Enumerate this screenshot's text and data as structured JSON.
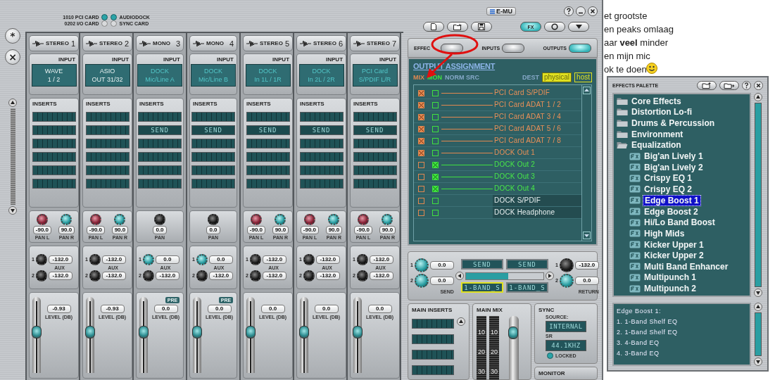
{
  "background_text": {
    "lines": [
      "et grootste",
      "en peaks omlaag",
      "aar **veel** minder",
      "en mijn mic",
      "ok te doen"
    ]
  },
  "mixer": {
    "rail": {
      "buttons": [
        "*",
        "×"
      ]
    },
    "legend": [
      {
        "label": "1010 PCI CARD",
        "on": true
      },
      {
        "label": "AUDIODOCK",
        "on": true
      },
      {
        "label": "0202 I/O CARD",
        "on": false
      },
      {
        "label": "SYNC CARD",
        "on": false
      }
    ],
    "channels": [
      {
        "kind": "stereo",
        "type_label": "STEREO",
        "number": "1",
        "input_label": "INPUT",
        "input": [
          "WAVE",
          "1 / 2"
        ],
        "lit": true,
        "inserts_label": "INSERTS",
        "pan": [
          {
            "value": "-90.0",
            "label": "PAN L"
          },
          {
            "value": "90.0",
            "label": "PAN R"
          }
        ],
        "aux_label": "AUX",
        "aux": [
          {
            "number": "1",
            "value": "-132.0",
            "on": false
          },
          {
            "number": "2",
            "value": "-132.0",
            "on": false
          }
        ],
        "level_value": "-0.93",
        "level_label": "LEVEL (DB)",
        "level": 0.55
      },
      {
        "kind": "stereo",
        "type_label": "STEREO",
        "number": "2",
        "input_label": "INPUT",
        "input": [
          "ASIO",
          "OUT 31/32"
        ],
        "lit": true,
        "inserts_label": "INSERTS",
        "pan": [
          {
            "value": "-90.0",
            "label": "PAN L"
          },
          {
            "value": "90.0",
            "label": "PAN R"
          }
        ],
        "aux_label": "AUX",
        "aux": [
          {
            "number": "1",
            "value": "-132.0",
            "on": false
          },
          {
            "number": "2",
            "value": "-132.0",
            "on": false
          }
        ],
        "level_value": "-0.93",
        "level_label": "LEVEL (DB)",
        "level": 0.55
      },
      {
        "kind": "mono",
        "type_label": "MONO",
        "number": "3",
        "input_label": "INPUT",
        "input": [
          "DOCK",
          "Mic/Line A"
        ],
        "lit": false,
        "inserts_label": "INSERTS",
        "send": "SEND",
        "pan": [
          {
            "value": "0.0",
            "label": "PAN"
          }
        ],
        "aux_label": "AUX",
        "aux": [
          {
            "number": "1",
            "value": "0.0",
            "on": true
          },
          {
            "number": "2",
            "value": "-132.0",
            "on": false
          }
        ],
        "badge": "PRE",
        "level_value": "0.0",
        "level_label": "LEVEL (DB)",
        "level": 0.55
      },
      {
        "kind": "mono",
        "type_label": "MONO",
        "number": "4",
        "input_label": "INPUT",
        "input": [
          "DOCK",
          "Mic/Line B"
        ],
        "lit": false,
        "inserts_label": "INSERTS",
        "send": "SEND",
        "pan": [
          {
            "value": "0.0",
            "label": "PAN"
          }
        ],
        "aux_label": "AUX",
        "aux": [
          {
            "number": "1",
            "value": "0.0",
            "on": true
          },
          {
            "number": "2",
            "value": "-132.0",
            "on": false
          }
        ],
        "badge": "PRE",
        "level_value": "0.0",
        "level_label": "LEVEL (DB)",
        "level": 0.55
      },
      {
        "kind": "stereo",
        "type_label": "STEREO",
        "number": "5",
        "input_label": "INPUT",
        "input": [
          "DOCK",
          "In 1L / 1R"
        ],
        "lit": false,
        "inserts_label": "INSERTS",
        "send": "SEND",
        "pan": [
          {
            "value": "-90.0",
            "label": "PAN L"
          },
          {
            "value": "90.0",
            "label": "PAN R"
          }
        ],
        "aux_label": "AUX",
        "aux": [
          {
            "number": "1",
            "value": "-132.0",
            "on": false
          },
          {
            "number": "2",
            "value": "-132.0",
            "on": false
          }
        ],
        "level_value": "0.0",
        "level_label": "LEVEL (DB)",
        "level": 0.55
      },
      {
        "kind": "stereo",
        "type_label": "STEREO",
        "number": "6",
        "input_label": "INPUT",
        "input": [
          "DOCK",
          "In 2L / 2R"
        ],
        "lit": false,
        "inserts_label": "INSERTS",
        "send": "SEND",
        "pan": [
          {
            "value": "-90.0",
            "label": "PAN L"
          },
          {
            "value": "90.0",
            "label": "PAN R"
          }
        ],
        "aux_label": "AUX",
        "aux": [
          {
            "number": "1",
            "value": "-132.0",
            "on": false
          },
          {
            "number": "2",
            "value": "-132.0",
            "on": false
          }
        ],
        "level_value": "0.0",
        "level_label": "LEVEL (DB)",
        "level": 0.55
      },
      {
        "kind": "stereo",
        "type_label": "STEREO",
        "number": "7",
        "input_label": "INPUT",
        "input": [
          "PCI Card",
          "S/PDIF L/R"
        ],
        "lit": false,
        "inserts_label": "INSERTS",
        "send": "SEND",
        "pan": [
          {
            "value": "-90.0",
            "label": "PAN L"
          },
          {
            "value": "90.0",
            "label": "PAN R"
          }
        ],
        "aux_label": "AUX",
        "aux": [
          {
            "number": "1",
            "value": "-132.0",
            "on": false
          },
          {
            "number": "2",
            "value": "-132.0",
            "on": false
          }
        ],
        "level_value": "0.0",
        "level_label": "LEVEL (DB)",
        "level": 0.55
      }
    ],
    "console": {
      "logo": "E-MU",
      "fx": {
        "label": "FX",
        "on": true
      },
      "tabs": [
        {
          "label": "EFFEC",
          "selected": false
        },
        {
          "label": "INPUTS",
          "selected": false
        },
        {
          "label": "OUTPUTS",
          "selected": true
        }
      ],
      "assignment": {
        "title": "OUTPUT ASSIGNMENT",
        "mix_header": "MIX",
        "mon_header": "MON",
        "norm_header": "NORM SRC",
        "dest_header": "DEST",
        "dest_toggle": [
          {
            "label": "physical",
            "selected": true
          },
          {
            "label": "host",
            "selected": false
          }
        ],
        "rows": [
          {
            "name": "PCI Card S/PDIF",
            "mix": true,
            "mon": false
          },
          {
            "name": "PCI Card ADAT 1 / 2",
            "mix": true,
            "mon": false
          },
          {
            "name": "PCI Card ADAT 3 / 4",
            "mix": true,
            "mon": false
          },
          {
            "name": "PCI Card ADAT 5 / 6",
            "mix": true,
            "mon": false
          },
          {
            "name": "PCI Card ADAT 7 / 8",
            "mix": true,
            "mon": false
          },
          {
            "name": "DOCK Out 1",
            "mix": true,
            "mon": false
          },
          {
            "name": "DOCK Out 2",
            "mix": false,
            "mon": true
          },
          {
            "name": "DOCK Out 3",
            "mix": false,
            "mon": true
          },
          {
            "name": "DOCK Out 4",
            "mix": false,
            "mon": true
          },
          {
            "name": "DOCK S/PDIF",
            "mix": false,
            "mon": false
          },
          {
            "name": "DOCK Headphone",
            "mix": false,
            "mon": false
          }
        ]
      },
      "send": {
        "label": "SEND",
        "knobs": [
          {
            "number": "1",
            "value": "0.0",
            "on": true
          },
          {
            "number": "2",
            "value": "0.0",
            "on": true
          }
        ],
        "slots": [
          "SEND",
          "SEND"
        ],
        "effects": [
          {
            "text": "1-BAND_S",
            "selected": true
          },
          {
            "text": "1-BAND_S",
            "selected": false
          }
        ]
      },
      "return": {
        "label": "RETURN",
        "knobs": [
          {
            "number": "1",
            "value": "-132.0",
            "on": false
          },
          {
            "number": "2",
            "value": "0.0",
            "on": true
          }
        ]
      },
      "main_inserts": {
        "title": "MAIN INSERTS"
      },
      "main_mix": {
        "title": "MAIN MIX",
        "meters": [
          {
            "scale": [
              "10",
              "20",
              "30"
            ]
          },
          {
            "scale": [
              "10",
              "20",
              "30"
            ]
          }
        ],
        "level": 0.8
      },
      "sync": {
        "title": "SYNC",
        "source_label": "SOURCE:",
        "source": "INTERNAL",
        "sr_label": "SR",
        "sr": "44.1KHZ",
        "locked": {
          "label": "LOCKED",
          "on": true
        }
      },
      "monitor": {
        "title": "MONITOR"
      }
    }
  },
  "palette": {
    "title": "EFFECTS PALETTE",
    "tree": [
      {
        "label": "Core Effects",
        "expanded": false,
        "selected": false
      },
      {
        "label": "Distortion Lo-fi",
        "expanded": false,
        "selected": false
      },
      {
        "label": "Drums & Percussion",
        "expanded": false,
        "selected": false
      },
      {
        "label": "Environment",
        "expanded": false,
        "selected": false
      },
      {
        "label": "Equalization",
        "expanded": true,
        "selected": false,
        "children": [
          {
            "label": "Big'an Lively 1",
            "selected": false
          },
          {
            "label": "Big'an Lively 2",
            "selected": false
          },
          {
            "label": "Crispy EQ 1",
            "selected": false
          },
          {
            "label": "Crispy EQ 2",
            "selected": false
          },
          {
            "label": "Edge Boost 1",
            "selected": true
          },
          {
            "label": "Edge Boost 2",
            "selected": false
          },
          {
            "label": "Hi/Lo Band Boost",
            "selected": false
          },
          {
            "label": "High Mids",
            "selected": false
          },
          {
            "label": "Kicker Upper 1",
            "selected": false
          },
          {
            "label": "Kicker Upper 2",
            "selected": false
          },
          {
            "label": "Multi Band Enhancer",
            "selected": false
          },
          {
            "label": "Multipunch 1",
            "selected": false
          },
          {
            "label": "Multipunch 2",
            "selected": false
          }
        ]
      }
    ],
    "details": [
      "Edge Boost 1:",
      "1. 1-Band Shelf EQ",
      "2. 1-Band Shelf EQ",
      "3. 4-Band EQ",
      "4. 3-Band EQ"
    ]
  }
}
